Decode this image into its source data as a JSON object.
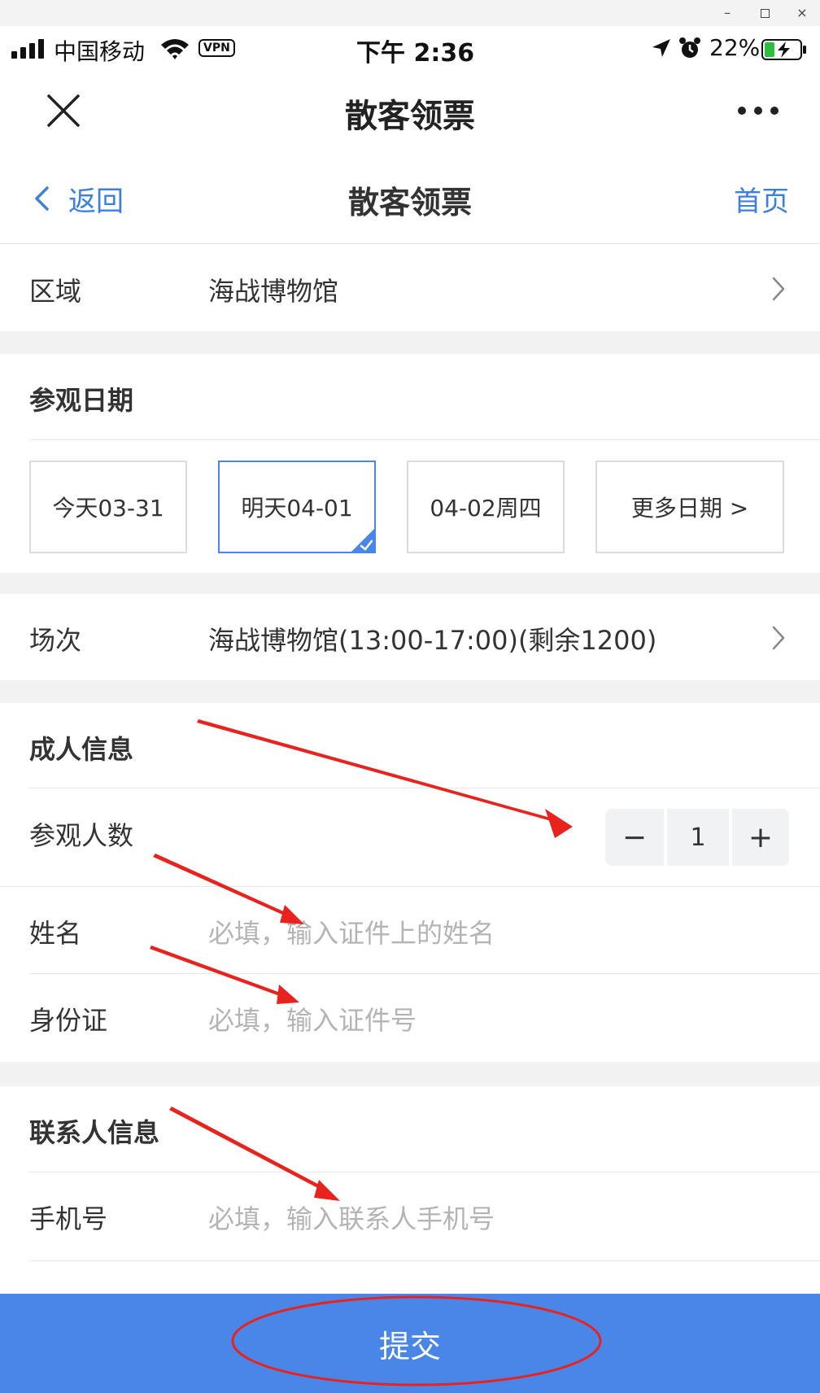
{
  "window": {
    "minimize": "–",
    "close": "×"
  },
  "status_bar": {
    "carrier": "中国移动",
    "vpn": "VPN",
    "time": "下午 2:36",
    "battery": "22%"
  },
  "nav": {
    "title": "散客领票"
  },
  "header": {
    "back": "返回",
    "title": "散客领票",
    "home": "首页"
  },
  "area": {
    "label": "区域",
    "value": "海战博物馆"
  },
  "visit_date": {
    "title": "参观日期",
    "options": [
      "今天03-31",
      "明天04-01",
      "04-02周四",
      "更多日期 >"
    ],
    "selected": "明天04-01"
  },
  "session": {
    "label": "场次",
    "value": "海战博物馆(13:00-17:00)(剩余1200)"
  },
  "adult_info": {
    "title": "成人信息",
    "count_label": "参观人数",
    "count": 1,
    "minus": "−",
    "plus": "+",
    "name_label": "姓名",
    "name_placeholder": "必填，输入证件上的姓名",
    "id_label": "身份证",
    "id_placeholder": "必填，输入证件号"
  },
  "contact_info": {
    "title": "联系人信息",
    "phone_label": "手机号",
    "phone_placeholder": "必填，输入联系人手机号"
  },
  "submit": {
    "label": "提交"
  },
  "colors": {
    "accent": "#4a86e8",
    "link": "#3d7fe0",
    "annotation": "#e8231e"
  }
}
